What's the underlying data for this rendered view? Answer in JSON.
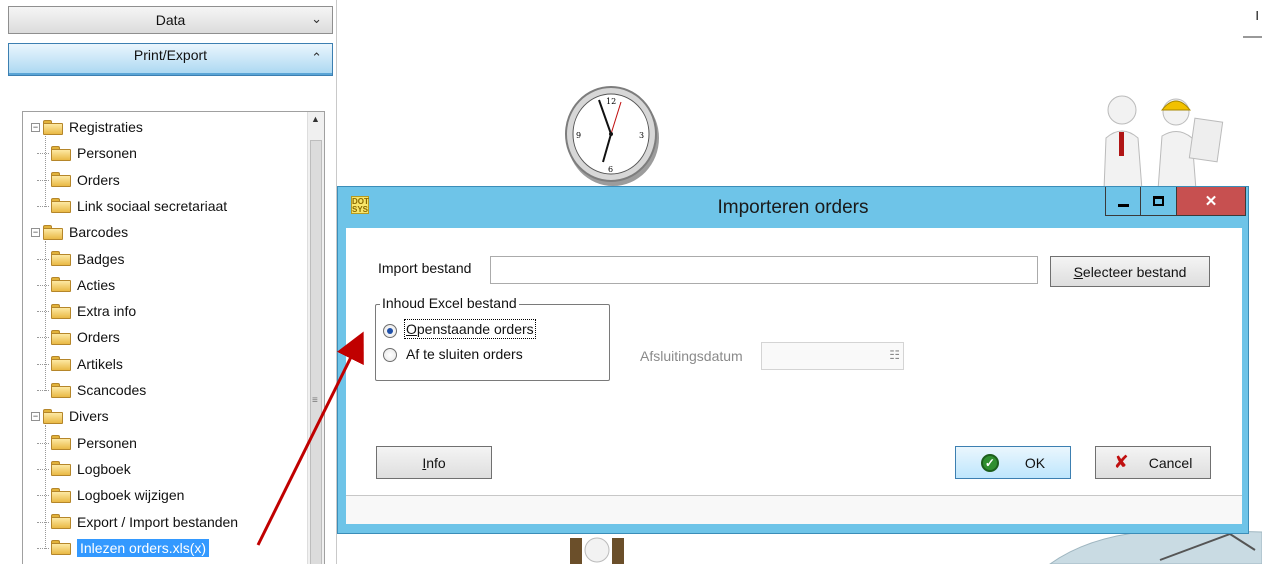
{
  "accordion": {
    "data_label": "Data",
    "print_label": "Print/Export"
  },
  "tree": [
    {
      "label": "Registraties",
      "level": 0,
      "expander": "−"
    },
    {
      "label": "Personen",
      "level": 1
    },
    {
      "label": "Orders",
      "level": 1
    },
    {
      "label": "Link sociaal secretariaat",
      "level": 1
    },
    {
      "label": "Barcodes",
      "level": 0,
      "expander": "−"
    },
    {
      "label": "Badges",
      "level": 1
    },
    {
      "label": "Acties",
      "level": 1
    },
    {
      "label": "Extra info",
      "level": 1
    },
    {
      "label": "Orders",
      "level": 1
    },
    {
      "label": "Artikels",
      "level": 1
    },
    {
      "label": "Scancodes",
      "level": 1
    },
    {
      "label": "Divers",
      "level": 0,
      "expander": "−"
    },
    {
      "label": "Personen",
      "level": 1
    },
    {
      "label": "Logboek",
      "level": 1
    },
    {
      "label": "Logboek wijzigen",
      "level": 1
    },
    {
      "label": "Export / Import bestanden",
      "level": 1
    },
    {
      "label": "Inlezen orders.xls(x)",
      "level": 1,
      "selected": true
    }
  ],
  "dialog": {
    "title": "Importeren orders",
    "app_icon_text": "DOT SYS",
    "import_label": "Import bestand",
    "import_value": "",
    "select_button": "Selecteer bestand",
    "group_legend": "Inhoud Excel bestand",
    "radio_open": "Openstaande orders",
    "radio_close": "Af te sluiten orders",
    "radio_selected": "open",
    "afsluitingsdatum_label": "Afsluitingsdatum",
    "afsluitingsdatum_value": "",
    "info_button": "Info",
    "ok_button": "OK",
    "cancel_button": "Cancel"
  },
  "corner_text": "I",
  "colors": {
    "dialog_frame": "#6ec4e8",
    "close_button": "#c75050",
    "selection": "#3399ff",
    "arrow": "#c00000"
  },
  "icons": [
    "chevron-down-icon",
    "chevron-up-icon",
    "folder-icon",
    "minimize-icon",
    "maximize-icon",
    "close-icon",
    "ok-check-icon",
    "cancel-x-icon",
    "calendar-icon",
    "clock-illustration",
    "people-illustration"
  ]
}
